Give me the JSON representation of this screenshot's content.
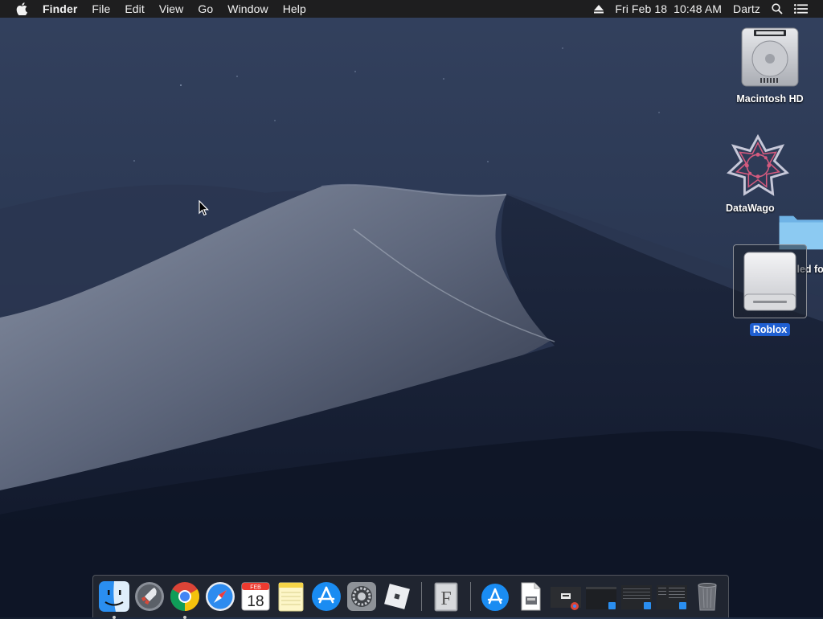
{
  "menubar": {
    "app_name": "Finder",
    "menus": [
      "File",
      "Edit",
      "View",
      "Go",
      "Window",
      "Help"
    ],
    "clock": "Fri Feb 18  10:48 AM",
    "user": "Dartz",
    "icons": [
      "apple-icon",
      "eject-icon",
      "spotlight-search-icon",
      "notification-center-icon"
    ]
  },
  "desktop": {
    "icons": [
      {
        "label": "Macintosh HD",
        "icon": "hard-drive-icon",
        "selected": false
      },
      {
        "label": "DataWago",
        "icon": "datawago-app-icon",
        "selected": false
      },
      {
        "label": "lled fo",
        "icon": "folder-icon",
        "selected": false
      },
      {
        "label": "Roblox",
        "icon": "external-disk-icon",
        "selected": true
      }
    ]
  },
  "dock": {
    "items": [
      {
        "name": "Finder",
        "icon": "finder-icon",
        "running": true
      },
      {
        "name": "Launchpad",
        "icon": "launchpad-icon",
        "running": false
      },
      {
        "name": "Google Chrome",
        "icon": "chrome-icon",
        "running": true
      },
      {
        "name": "Safari",
        "icon": "safari-icon",
        "running": false
      },
      {
        "name": "Calendar",
        "icon": "calendar-icon",
        "running": false,
        "month": "FEB",
        "day": "18"
      },
      {
        "name": "Notes",
        "icon": "notes-icon",
        "running": false
      },
      {
        "name": "App Store",
        "icon": "app-store-icon",
        "running": false
      },
      {
        "name": "System Preferences",
        "icon": "system-preferences-icon",
        "running": false
      },
      {
        "name": "Roblox",
        "icon": "roblox-icon",
        "running": false
      },
      {
        "name": "Font Book",
        "icon": "font-book-icon",
        "running": false,
        "glyph": "F"
      },
      {
        "name": "App Store Downloads",
        "icon": "app-store-folder-icon",
        "running": false
      },
      {
        "name": "Document",
        "icon": "document-icon",
        "running": false
      },
      {
        "name": "Chrome Window",
        "icon": "chrome-window-thumbnail-icon",
        "running": false
      },
      {
        "name": "Finder Window",
        "icon": "finder-window-thumbnail-icon",
        "running": false
      },
      {
        "name": "Finder Window 2",
        "icon": "finder-window-thumbnail-icon-2",
        "running": false
      },
      {
        "name": "Finder Window 3",
        "icon": "finder-window-thumbnail-icon-3",
        "running": false
      },
      {
        "name": "Trash",
        "icon": "trash-icon",
        "running": false
      }
    ]
  },
  "colors": {
    "menubar_bg": "#1e1e1f",
    "selection": "#1f5fd1",
    "dock_bg": "#2c3038"
  }
}
